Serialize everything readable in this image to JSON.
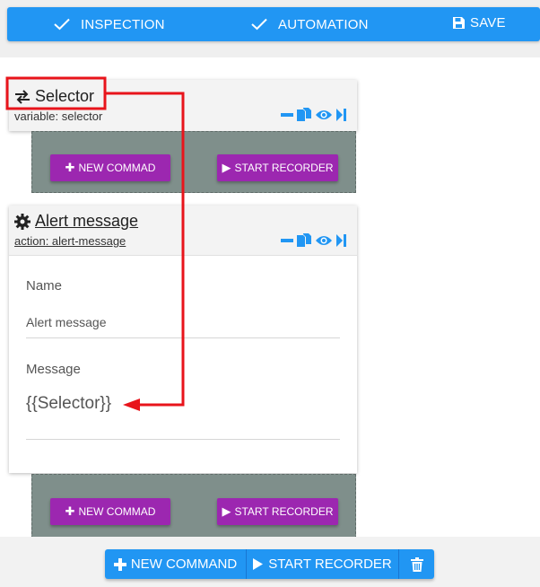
{
  "toolbar": {
    "inspection_label": "INSPECTION",
    "automation_label": "AUTOMATION",
    "save_label": "SAVE"
  },
  "selector_card": {
    "title": "Selector",
    "subtitle": "variable: selector",
    "new_command_label": "NEW COMMAD",
    "start_recorder_label": "START RECORDER"
  },
  "alert_card": {
    "title": "Alert message",
    "subtitle": "action: alert-message",
    "fields": [
      {
        "label": "Name",
        "value": "Alert message"
      },
      {
        "label": "Message",
        "value": "{{Selector}}"
      }
    ],
    "new_command_label": "NEW COMMAD",
    "start_recorder_label": "START RECORDER"
  },
  "bottom_bar": {
    "new_command_label": "NEW COMMAND",
    "start_recorder_label": "START RECORDER"
  },
  "colors": {
    "primary_blue": "#2196f3",
    "action_purple": "#9c27b0",
    "dropzone_gray": "#7f8f8b",
    "annotation_red": "#e8141b"
  },
  "icons": {
    "toolbar": [
      "check-icon",
      "check-icon",
      "save-icon"
    ],
    "card_actions": [
      "minus-icon",
      "copy-icon",
      "eye-icon",
      "skip-end-icon"
    ],
    "selector_card": "swap-arrows-icon",
    "alert_card": "gear-icon",
    "bottom_bar": [
      "plus-icon",
      "play-icon",
      "trash-icon"
    ]
  }
}
